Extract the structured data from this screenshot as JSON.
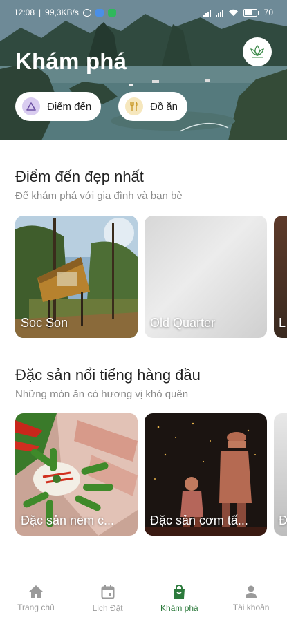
{
  "status_bar": {
    "time": "12:08",
    "speed": "99,3KB/s",
    "battery": "70"
  },
  "hero": {
    "title": "Khám phá",
    "chips": [
      {
        "label": "Điểm đến",
        "icon": "mountain-icon"
      },
      {
        "label": "Đồ ăn",
        "icon": "utensils-icon"
      }
    ]
  },
  "destinations": {
    "title": "Điểm đến đẹp nhất",
    "subtitle": "Để khám phá với gia đình và bạn bè",
    "cards": [
      {
        "label": "Soc Son"
      },
      {
        "label": "Old Quarter"
      },
      {
        "label": "L"
      }
    ]
  },
  "foods": {
    "title": "Đặc sản nổi tiếng hàng đầu",
    "subtitle": "Những món ăn có hương vị khó quên",
    "cards": [
      {
        "label": "Đặc sản nem c..."
      },
      {
        "label": "Đặc sản cơm tấ..."
      },
      {
        "label": "Đ"
      }
    ]
  },
  "bottom_nav": {
    "items": [
      {
        "label": "Trang chủ",
        "icon": "home-icon"
      },
      {
        "label": "Lịch Đặt",
        "icon": "calendar-icon"
      },
      {
        "label": "Khám phá",
        "icon": "shopping-bag-icon",
        "active": true
      },
      {
        "label": "Tài khoản",
        "icon": "user-icon"
      }
    ]
  },
  "colors": {
    "accent": "#2c7a3c",
    "inactive": "#9a9a9a"
  }
}
